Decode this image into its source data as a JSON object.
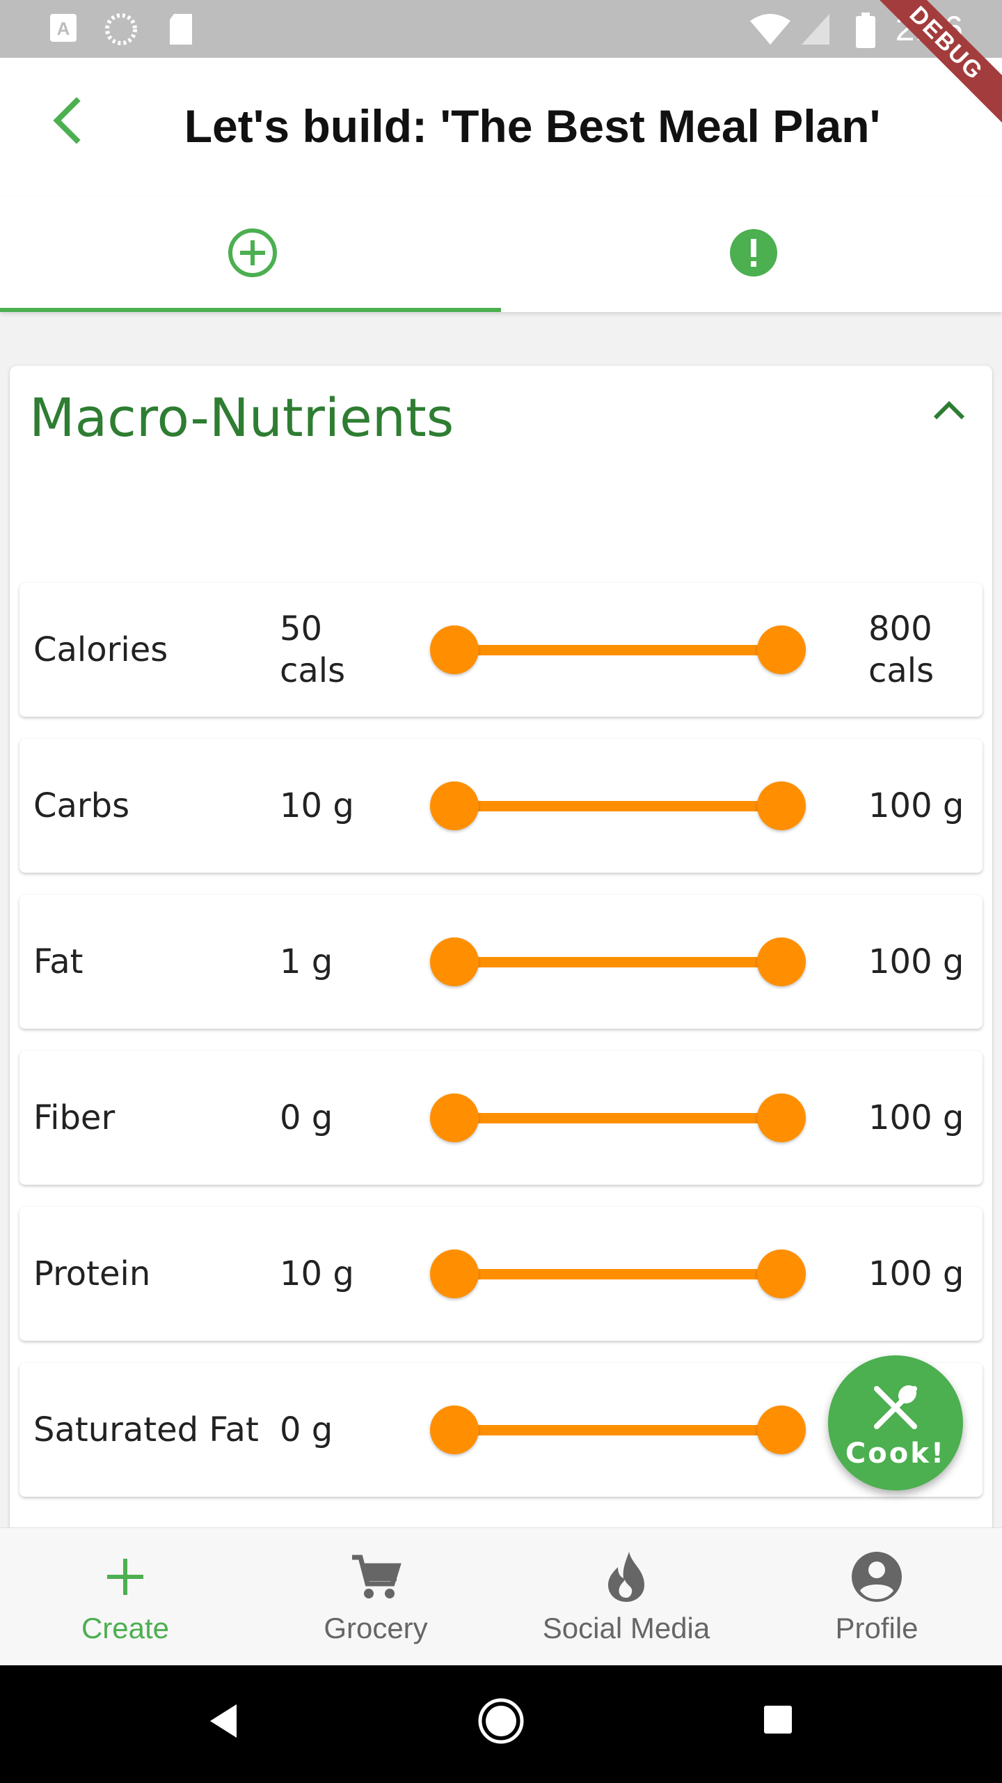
{
  "status_bar": {
    "time": "2:26",
    "icons": [
      "a-notification-icon",
      "loading-icon",
      "sd-card-icon",
      "wifi-icon",
      "signal-icon",
      "battery-icon"
    ]
  },
  "debug_banner": "DEBUG",
  "app_bar": {
    "title": "Let's build: 'The Best Meal Plan'",
    "back_icon": "back-arrow-icon"
  },
  "tabs": [
    {
      "icon": "add-circle-icon",
      "selected": true
    },
    {
      "icon": "alert-icon",
      "selected": false
    }
  ],
  "section": {
    "title": "Macro-Nutrients",
    "expanded": true
  },
  "nutrients": [
    {
      "label": "Calories",
      "min": "50 cals",
      "max": "800 cals",
      "lower_fraction": 0.0,
      "upper_fraction": 1.0
    },
    {
      "label": "Carbs",
      "min": "10 g",
      "max": "100 g",
      "lower_fraction": 0.0,
      "upper_fraction": 1.0
    },
    {
      "label": "Fat",
      "min": "1 g",
      "max": "100 g",
      "lower_fraction": 0.0,
      "upper_fraction": 1.0
    },
    {
      "label": "Fiber",
      "min": "0 g",
      "max": "100 g",
      "lower_fraction": 0.0,
      "upper_fraction": 1.0
    },
    {
      "label": "Protein",
      "min": "10 g",
      "max": "100 g",
      "lower_fraction": 0.0,
      "upper_fraction": 1.0
    },
    {
      "label": "Saturated Fat",
      "min": "0 g",
      "max": "",
      "lower_fraction": 0.0,
      "upper_fraction": 1.0
    }
  ],
  "fab": {
    "label": "Cook!",
    "icon": "utensils-icon"
  },
  "bottom_nav": [
    {
      "label": "Create",
      "icon": "plus-icon",
      "active": true
    },
    {
      "label": "Grocery",
      "icon": "cart-icon",
      "active": false
    },
    {
      "label": "Social Media",
      "icon": "flame-icon",
      "active": false
    },
    {
      "label": "Profile",
      "icon": "account-circle-icon",
      "active": false
    }
  ],
  "colors": {
    "accent": "#4caf50",
    "title_green": "#2e7d32",
    "slider": "#ff8f00"
  }
}
